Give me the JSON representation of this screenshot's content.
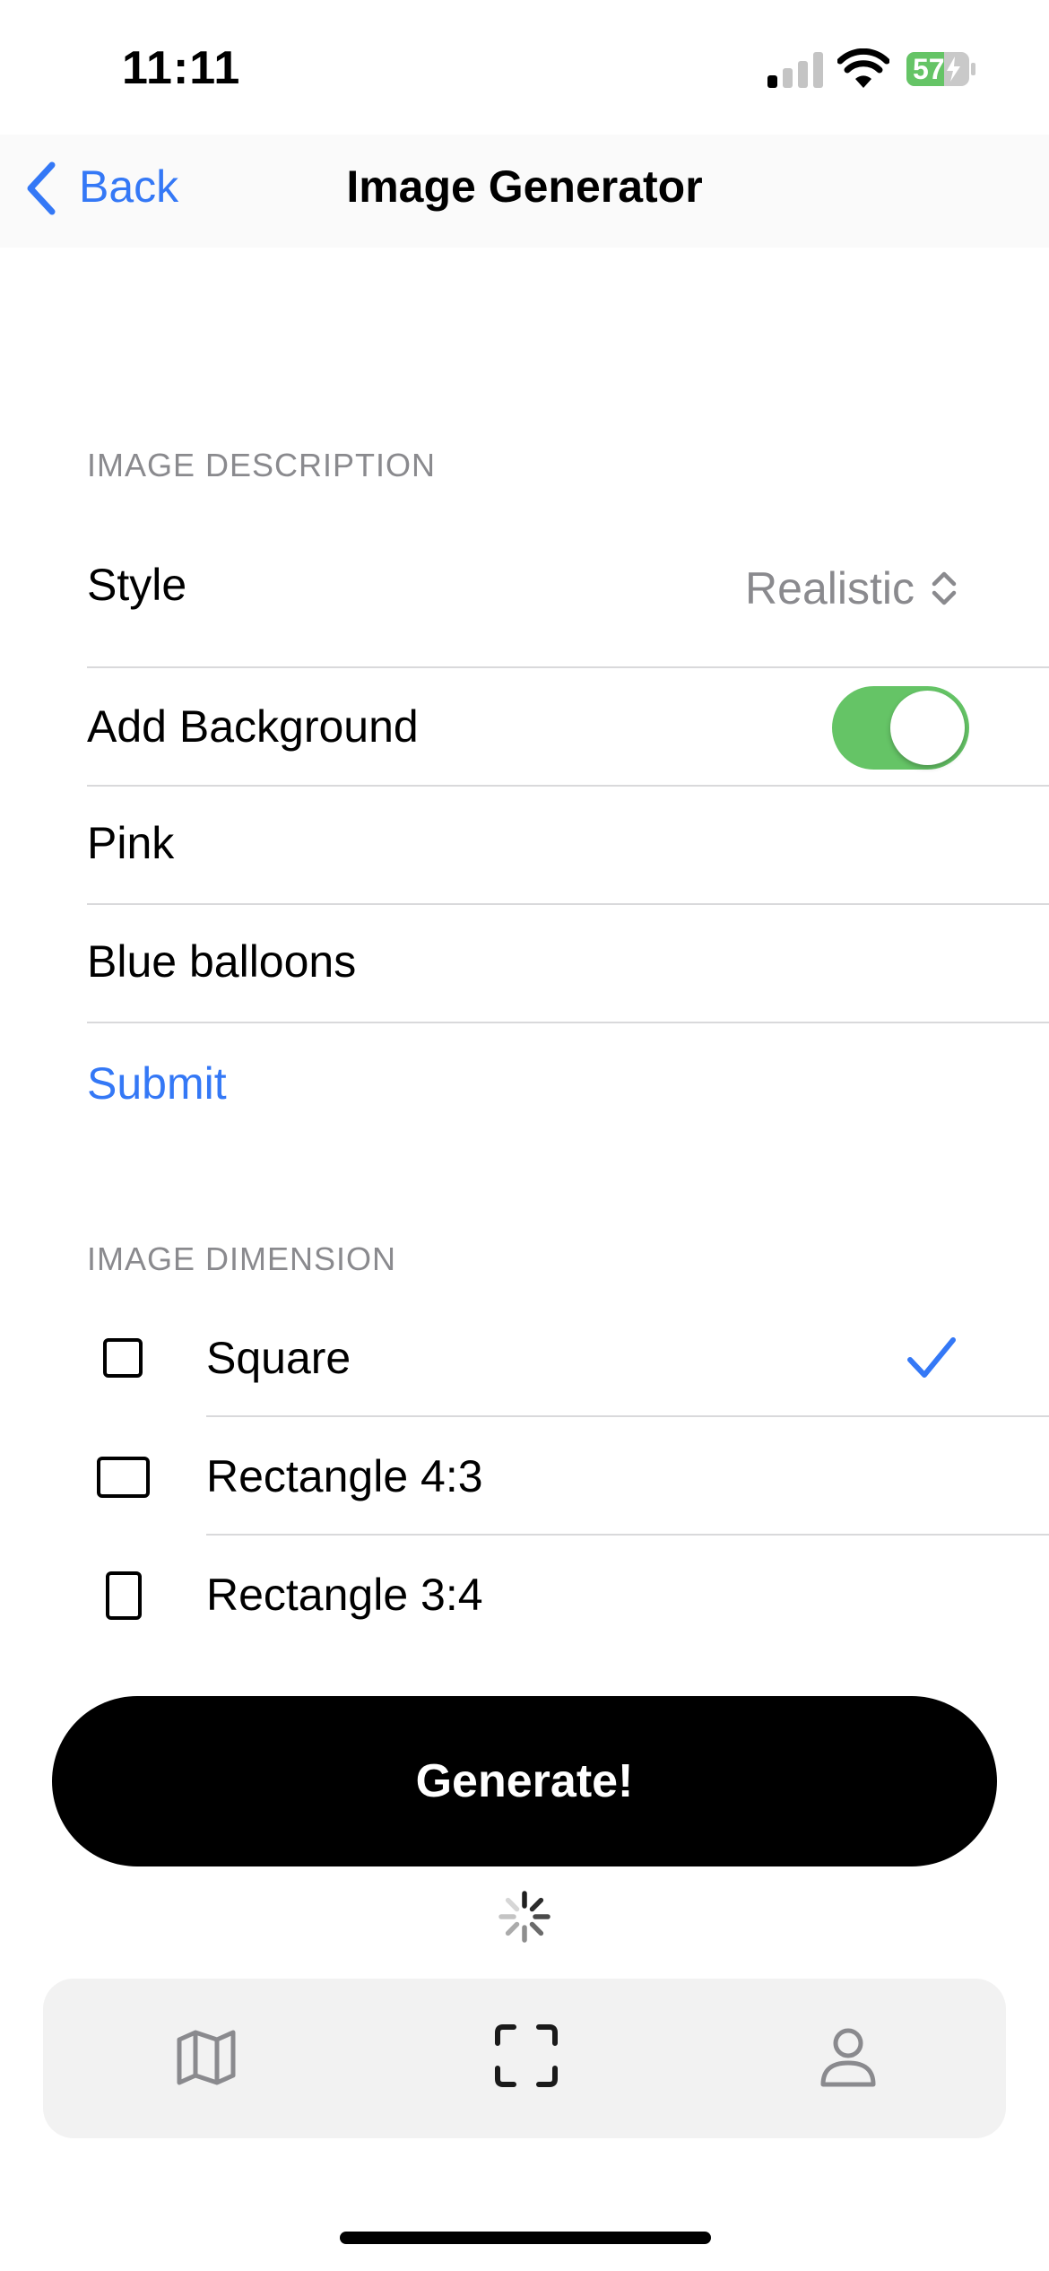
{
  "status_bar": {
    "time": "11:11",
    "battery": "57"
  },
  "nav": {
    "back_label": "Back",
    "title": "Image Generator"
  },
  "image_description": {
    "header": "IMAGE DESCRIPTION",
    "style_label": "Style",
    "style_value": "Realistic",
    "add_background_label": "Add Background",
    "add_background_on": true,
    "background_color_value": "Pink",
    "background_item_value": "Blue balloons",
    "submit_label": "Submit"
  },
  "image_dimension": {
    "header": "IMAGE DIMENSION",
    "options": [
      {
        "label": "Square",
        "selected": true
      },
      {
        "label": "Rectangle 4:3",
        "selected": false
      },
      {
        "label": "Rectangle 3:4",
        "selected": false
      }
    ]
  },
  "generate_button_label": "Generate!",
  "tabs": [
    {
      "icon": "map-icon",
      "active": false
    },
    {
      "icon": "scan-frame-icon",
      "active": true
    },
    {
      "icon": "person-icon",
      "active": false
    }
  ],
  "colors": {
    "accent": "#3478f6",
    "toggle_on": "#65c466",
    "secondary_text": "#8a8a8e",
    "battery_fill": "#65c466"
  }
}
